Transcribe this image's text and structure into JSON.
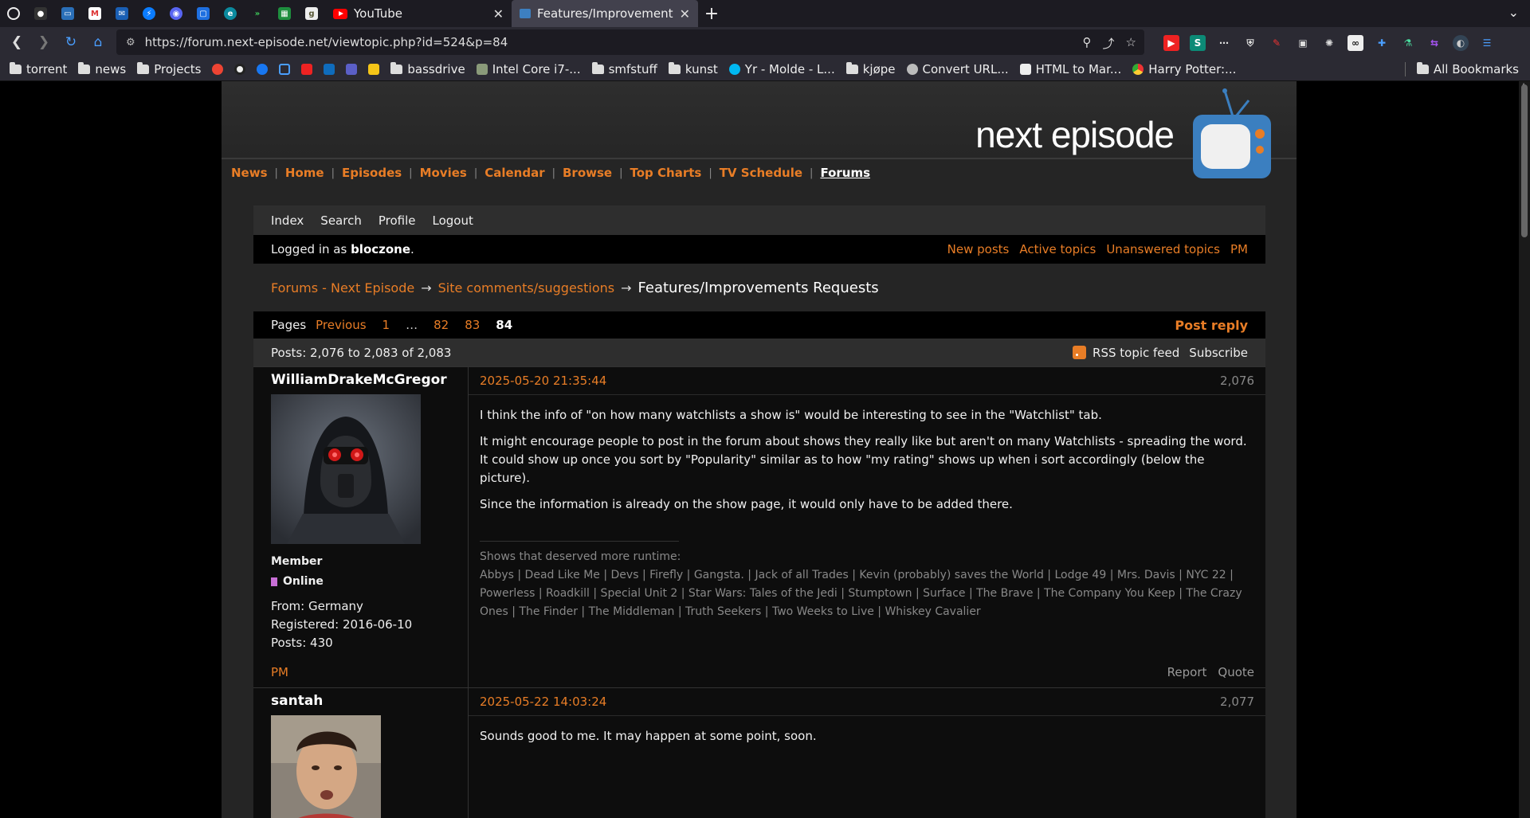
{
  "browser": {
    "tabs": [
      {
        "title": "YouTube",
        "active": false
      },
      {
        "title": "Features/Improvement",
        "active": true
      }
    ],
    "url": "https://forum.next-episode.net/viewtopic.php?id=524&p=84",
    "bookmarks": [
      "torrent",
      "news",
      "Projects",
      "bassdrive",
      "Intel Core i7-...",
      "smfstuff",
      "kunst",
      "Yr - Molde - L...",
      "kjøpe",
      "Convert URL...",
      "HTML to Mar...",
      "Harry Potter:..."
    ],
    "all_bookmarks": "All Bookmarks"
  },
  "site": {
    "logo": "next episode",
    "nav": [
      "News",
      "Home",
      "Episodes",
      "Movies",
      "Calendar",
      "Browse",
      "Top Charts",
      "TV Schedule",
      "Forums"
    ]
  },
  "forum": {
    "menu": [
      "Index",
      "Search",
      "Profile",
      "Logout"
    ],
    "logged_prefix": "Logged in as",
    "username": "bloczone",
    "status_links": [
      "New posts",
      "Active topics",
      "Unanswered topics",
      "PM"
    ],
    "crumbs": [
      "Forums - Next Episode",
      "Site comments/suggestions",
      "Features/Improvements Requests"
    ],
    "pages_label": "Pages",
    "pages": [
      "Previous",
      "1",
      "…",
      "82",
      "83",
      "84"
    ],
    "post_reply": "Post reply",
    "post_count": "Posts: 2,076 to 2,083 of 2,083",
    "rss": "RSS topic feed",
    "subscribe": "Subscribe"
  },
  "posts": [
    {
      "author": "WilliamDrakeMcGregor",
      "rank": "Member",
      "online": "Online",
      "from": "From: Germany",
      "registered": "Registered: 2016-06-10",
      "posts": "Posts: 430",
      "pm": "PM",
      "date": "2025-05-20 21:35:44",
      "num": "2,076",
      "p1": "I think the info of \"on how many watchlists a show is\" would be interesting to see in the \"Watchlist\" tab.",
      "p2a": "It might encourage people to post in the forum about shows they really like but aren't on many Watchlists - spreading the word.",
      "p2b": "It could show up once you sort by \"Popularity\" similar as to how \"my rating\" shows up when i sort accordingly (below the picture).",
      "p3": "Since the information is already on the show page, it would only have to be added there.",
      "sig_title": "Shows that deserved more runtime:",
      "sig_list": "Abbys | Dead Like Me | Devs | Firefly | Gangsta. | Jack of all Trades | Kevin (probably) saves the World | Lodge 49 | Mrs. Davis | NYC 22 | Powerless | Roadkill | Special Unit 2 | Star Wars: Tales of the Jedi | Stumptown | Surface | The Brave | The Company You Keep | The Crazy Ones | The Finder | The Middleman | Truth Seekers | Two Weeks to Live | Whiskey Cavalier",
      "report": "Report",
      "quote": "Quote"
    },
    {
      "author": "santah",
      "date": "2025-05-22 14:03:24",
      "num": "2,077",
      "p1": "Sounds good to me. It may happen at some point, soon."
    }
  ]
}
